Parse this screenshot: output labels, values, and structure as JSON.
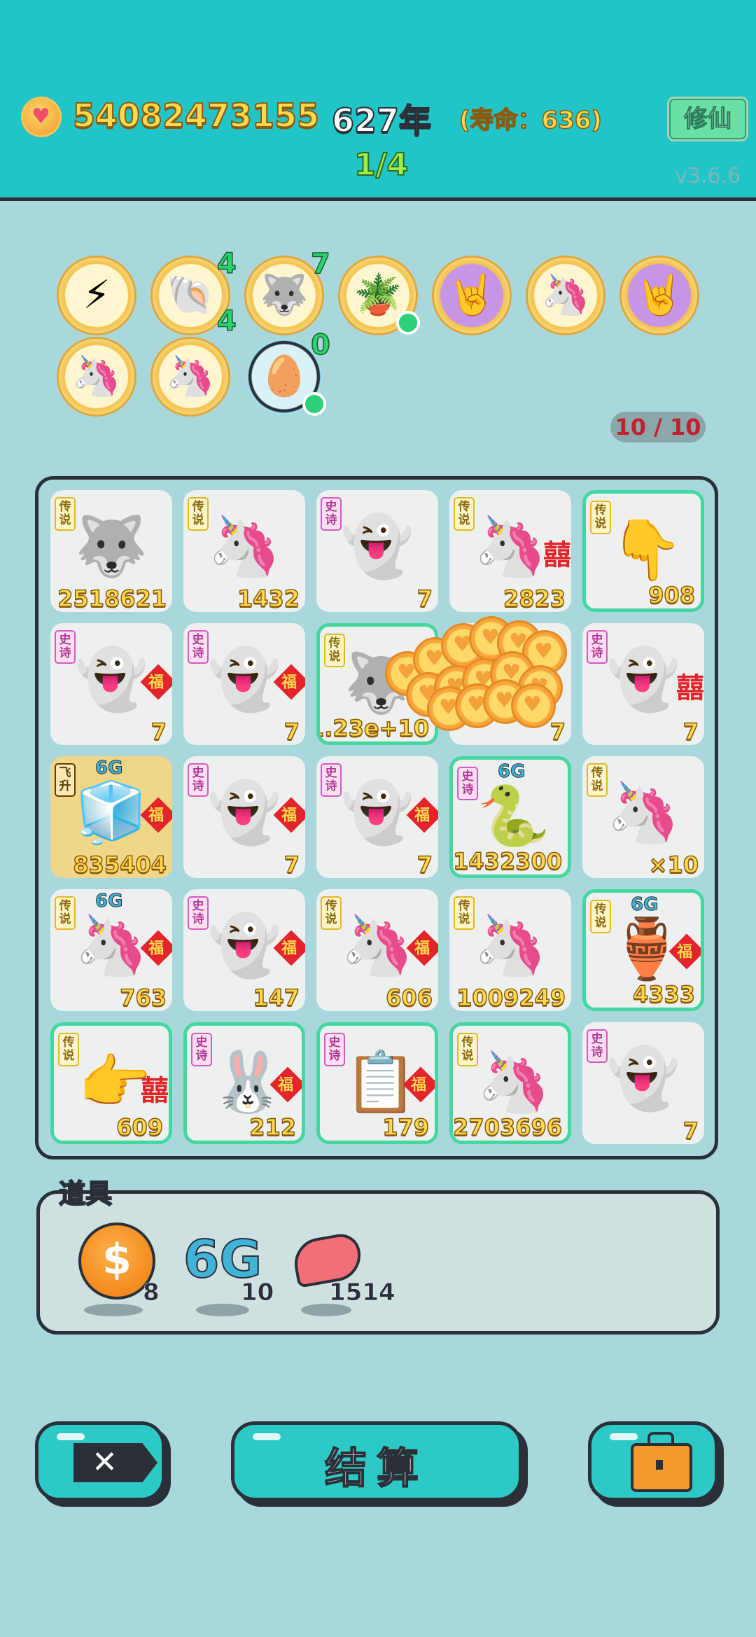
{
  "header": {
    "currency_icon": "heart-coin-icon",
    "currency_amount": "54082473155",
    "year": "627年",
    "lifespan": "(寿命：636)",
    "progress": "1/4",
    "cultivate_button": "修仙",
    "version": "v3.6.6"
  },
  "buffs": [
    {
      "icon": "lightning-icon",
      "emoji": "⚡"
    },
    {
      "icon": "shell-icon",
      "emoji": "🐚",
      "count_top": "4",
      "count_bottom": "4"
    },
    {
      "icon": "husky-icon",
      "emoji": "🐺",
      "count_top": "7"
    },
    {
      "icon": "flower-pot-icon",
      "emoji": "🪴"
    },
    {
      "icon": "rock-hand-icon",
      "emoji": "🤘"
    },
    {
      "icon": "unicorn-icon",
      "emoji": "🦄"
    },
    {
      "icon": "rock-hand-icon",
      "emoji": "🤘"
    },
    {
      "icon": "unicorn-icon",
      "emoji": "🦄"
    },
    {
      "icon": "unicorn-icon",
      "emoji": "🦄"
    },
    {
      "icon": "egg-tray-icon",
      "emoji": "🥚",
      "count_top": "0"
    }
  ],
  "capacity": "10 / 10",
  "board": {
    "tiles": [
      {
        "tag": "传说",
        "tag_type": "legend",
        "icon": "husky-king-icon",
        "emoji": "🐺",
        "value": "2518621"
      },
      {
        "tag": "传说",
        "tag_type": "legend",
        "icon": "unicorn-king-icon",
        "emoji": "🦄",
        "value": "1432"
      },
      {
        "tag": "史诗",
        "tag_type": "epic",
        "icon": "ghost-icon",
        "emoji": "👻",
        "value": "7"
      },
      {
        "tag": "传说",
        "tag_type": "legend",
        "icon": "unicorn-king-icon",
        "emoji": "🦄",
        "value": "2823",
        "mark": "囍"
      },
      {
        "tag": "传说",
        "tag_type": "legend",
        "icon": "pointing-hand-icon",
        "emoji": "👇",
        "value": "908",
        "highlight": true
      },
      {
        "tag": "史诗",
        "tag_type": "epic",
        "icon": "ghost-icon",
        "emoji": "👻",
        "value": "7",
        "mark": "福"
      },
      {
        "tag": "史诗",
        "tag_type": "epic",
        "icon": "ghost-icon",
        "emoji": "👻",
        "value": "7",
        "mark": "福"
      },
      {
        "tag": "传说",
        "tag_type": "legend",
        "icon": "husky-king-icon",
        "emoji": "🐺",
        "value": "1.23e+10",
        "highlight": true
      },
      {
        "tag": "",
        "tag_type": "",
        "icon": "ghost-icon",
        "emoji": "👻",
        "value": "7"
      },
      {
        "tag": "史诗",
        "tag_type": "epic",
        "icon": "ghost-icon",
        "emoji": "👻",
        "value": "7",
        "mark": "囍"
      },
      {
        "tag": "飞升",
        "tag_type": "ascend",
        "icon": "fridge-icon",
        "emoji": "🧊",
        "value": "835404",
        "mark": "福",
        "six_g": "6G",
        "gold": true
      },
      {
        "tag": "史诗",
        "tag_type": "epic",
        "icon": "ghost-icon",
        "emoji": "👻",
        "value": "7",
        "mark": "福"
      },
      {
        "tag": "史诗",
        "tag_type": "epic",
        "icon": "ghost-icon",
        "emoji": "👻",
        "value": "7",
        "mark": "福"
      },
      {
        "tag": "史诗",
        "tag_type": "epic",
        "icon": "snake-icon",
        "emoji": "🐍",
        "value": "1432300",
        "six_g": "6G",
        "highlight": true
      },
      {
        "tag": "传说",
        "tag_type": "legend",
        "icon": "unicorn-king-icon",
        "emoji": "🦄",
        "value": "×10"
      },
      {
        "tag": "传说",
        "tag_type": "legend",
        "icon": "unicorn-king-icon",
        "emoji": "🦄",
        "value": "763",
        "mark": "福",
        "six_g": "6G"
      },
      {
        "tag": "史诗",
        "tag_type": "epic",
        "icon": "ghost-icon",
        "emoji": "👻",
        "value": "147",
        "mark": "福"
      },
      {
        "tag": "传说",
        "tag_type": "legend",
        "icon": "unicorn-king-icon",
        "emoji": "🦄",
        "value": "606",
        "mark": "福"
      },
      {
        "tag": "传说",
        "tag_type": "legend",
        "icon": "unicorn-king-icon",
        "emoji": "🦄",
        "value": "1009249"
      },
      {
        "tag": "传说",
        "tag_type": "legend",
        "icon": "green-vase-icon",
        "emoji": "🏺",
        "value": "4333",
        "mark": "福",
        "six_g": "6G",
        "highlight": true
      },
      {
        "tag": "传说",
        "tag_type": "legend",
        "icon": "pointing-hand-icon",
        "emoji": "👉",
        "value": "609",
        "mark": "囍",
        "highlight": true
      },
      {
        "tag": "史诗",
        "tag_type": "epic",
        "icon": "rabbit-tent-icon",
        "emoji": "🐰",
        "value": "212",
        "mark": "福",
        "highlight": true
      },
      {
        "tag": "史诗",
        "tag_type": "epic",
        "icon": "ctrl-c-v-icon",
        "emoji": "📋",
        "value": "179",
        "mark": "福",
        "highlight": true
      },
      {
        "tag": "传说",
        "tag_type": "legend",
        "icon": "unicorn-icon",
        "emoji": "🦄",
        "value": "2703696",
        "highlight": true
      },
      {
        "tag": "史诗",
        "tag_type": "epic",
        "icon": "ghost-icon",
        "emoji": "👻",
        "value": "7"
      }
    ]
  },
  "props": {
    "label": "道具",
    "items": [
      {
        "icon": "dollar-coin-icon",
        "symbol": "$",
        "count": "8"
      },
      {
        "icon": "6g-icon",
        "symbol": "6G",
        "count": "10"
      },
      {
        "icon": "liver-icon",
        "count": "1514"
      }
    ]
  },
  "actions": {
    "close_icon": "close-icon",
    "settle_label": "结算",
    "bag_icon": "briefcase-icon"
  }
}
